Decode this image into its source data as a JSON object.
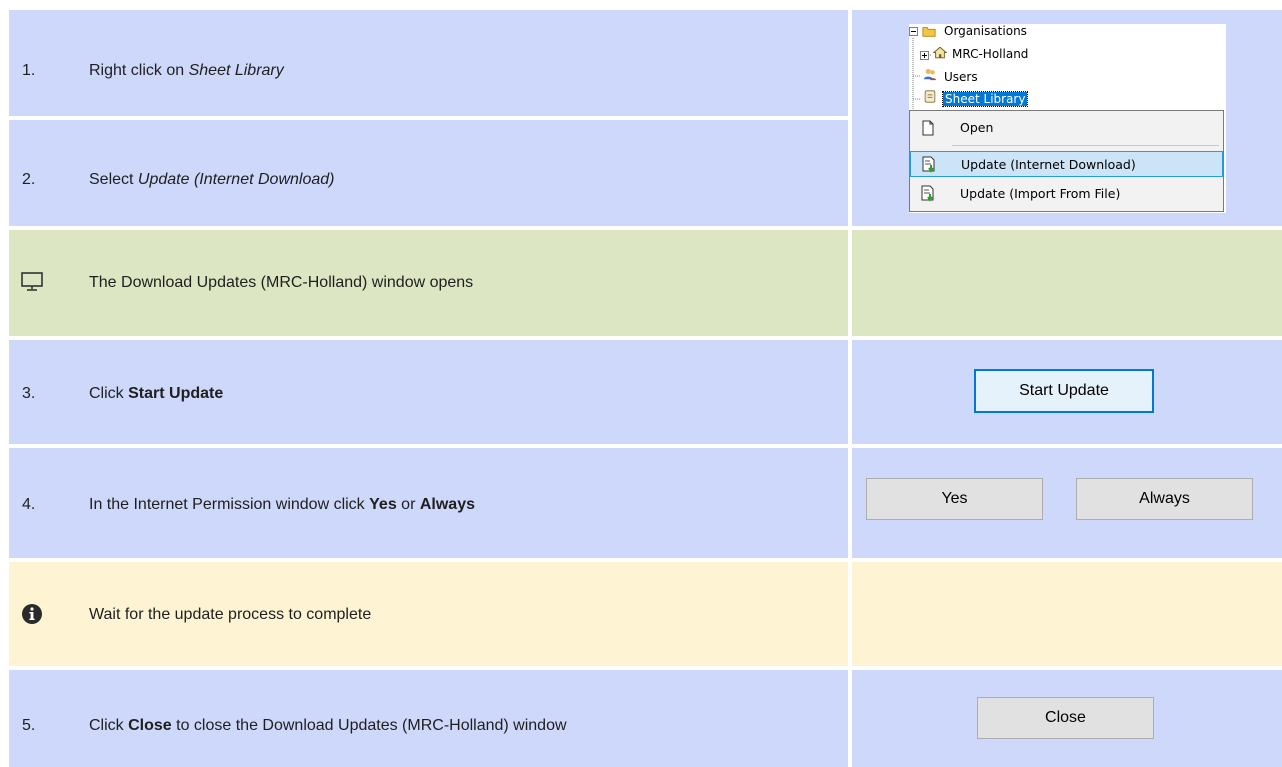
{
  "steps": [
    {
      "number": "1.",
      "text_before": "Right click on ",
      "emphasis": "Sheet Library",
      "text_after": ""
    },
    {
      "number": "2.",
      "text_before": "Select ",
      "emphasis": "Update (Internet Download)",
      "text_after": ""
    },
    {
      "text": "The Download Updates (MRC-Holland) window opens",
      "icon": "monitor-icon"
    },
    {
      "number": "3.",
      "text_before": "Click ",
      "bold": "Start Update"
    },
    {
      "number": "4.",
      "text_before": "In the Internet Permission window click ",
      "bold1": "Yes",
      "mid": " or ",
      "bold2": "Always"
    },
    {
      "text": "Wait for the update process to complete",
      "icon": "info-icon"
    },
    {
      "number": "5.",
      "text_before": "Click ",
      "bold": "Close",
      "text_after": " to close the Download Updates (MRC-Holland) window"
    }
  ],
  "tree": {
    "items": [
      {
        "label": "Organisations",
        "icon": "folder-icon"
      },
      {
        "label": "MRC-Holland",
        "icon": "house-icon"
      },
      {
        "label": "Users",
        "icon": "users-icon"
      },
      {
        "label": "Sheet Library",
        "icon": "library-icon"
      }
    ]
  },
  "context_menu": {
    "items": [
      {
        "label": "Open",
        "icon": "open-document-icon"
      },
      {
        "label": "Update (Internet Download)",
        "icon": "download-document-icon"
      },
      {
        "label": "Update (Import From File)",
        "icon": "import-document-icon"
      }
    ]
  },
  "buttons": {
    "start_update": "Start Update",
    "yes": "Yes",
    "always": "Always",
    "close": "Close"
  },
  "colors": {
    "step_background": "#cdd8fb",
    "screen_background": "#dde6c3",
    "info_background": "#fef3d2",
    "highlight": "#0078d7"
  }
}
